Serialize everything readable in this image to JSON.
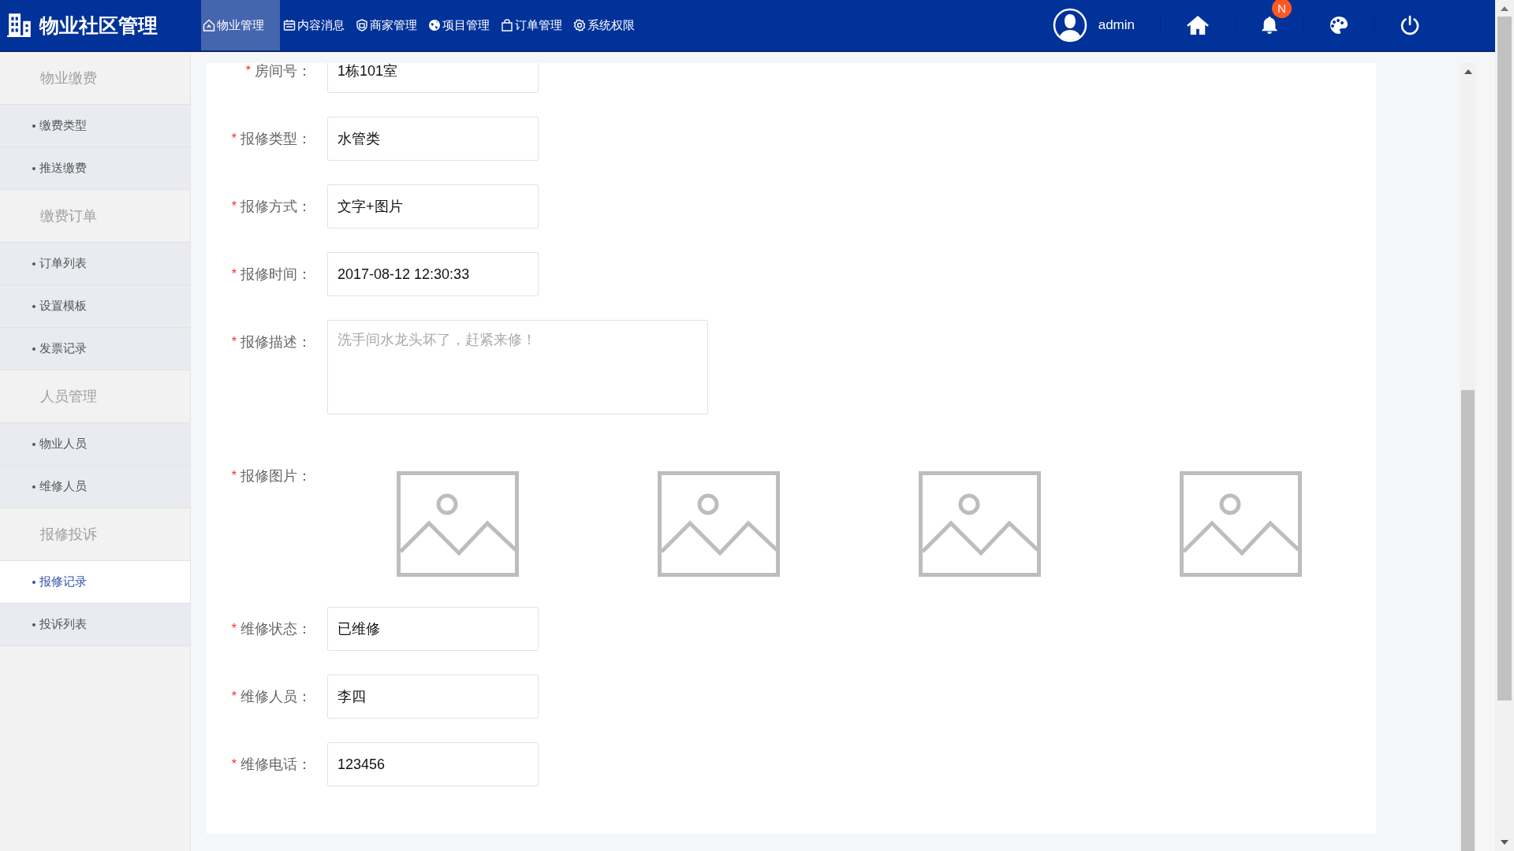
{
  "app": {
    "title": "物业社区管理"
  },
  "nav": [
    {
      "label": "物业管理",
      "selected": true
    },
    {
      "label": "内容消息",
      "selected": false
    },
    {
      "label": "商家管理",
      "selected": false
    },
    {
      "label": "项目管理",
      "selected": false
    },
    {
      "label": "订单管理",
      "selected": false
    },
    {
      "label": "系统权限",
      "selected": false
    }
  ],
  "user": {
    "name": "admin"
  },
  "notifications": {
    "badge": "N"
  },
  "sidebar": [
    {
      "title": "物业缴费",
      "items": [
        {
          "label": "缴费类型",
          "selected": false
        },
        {
          "label": "推送缴费",
          "selected": false
        }
      ]
    },
    {
      "title": "缴费订单",
      "items": [
        {
          "label": "订单列表",
          "selected": false
        },
        {
          "label": "设置模板",
          "selected": false
        },
        {
          "label": "发票记录",
          "selected": false
        }
      ]
    },
    {
      "title": "人员管理",
      "items": [
        {
          "label": "物业人员",
          "selected": false
        },
        {
          "label": "维修人员",
          "selected": false
        }
      ]
    },
    {
      "title": "报修投诉",
      "items": [
        {
          "label": "报修记录",
          "selected": true
        },
        {
          "label": "投诉列表",
          "selected": false
        }
      ]
    }
  ],
  "form": {
    "fields": [
      {
        "kind": "input",
        "required_mark": "*",
        "label": "房间号：",
        "value": "1栋101室"
      },
      {
        "kind": "input",
        "required_mark": "*",
        "label": "报修类型：",
        "value": "水管类"
      },
      {
        "kind": "input",
        "required_mark": "*",
        "label": "报修方式：",
        "value": "文字+图片"
      },
      {
        "kind": "input",
        "required_mark": "*",
        "label": "报修时间：",
        "value": "2017-08-12 12:30:33"
      },
      {
        "kind": "textarea",
        "required_mark": "*",
        "label": "报修描述：",
        "placeholder": "洗手间水龙头坏了，赶紧来修！"
      },
      {
        "kind": "images",
        "required_mark": "*",
        "label": "报修图片：",
        "images": [
          {
            "kind": "placeholder"
          },
          {
            "kind": "placeholder"
          },
          {
            "kind": "placeholder"
          },
          {
            "kind": "placeholder"
          }
        ]
      },
      {
        "kind": "input",
        "required_mark": "*",
        "label": "维修状态：",
        "value": "已维修"
      },
      {
        "kind": "input",
        "required_mark": "*",
        "label": "维修人员：",
        "value": "李四"
      },
      {
        "kind": "input",
        "required_mark": "*",
        "label": "维修电话：",
        "value": "123456"
      }
    ]
  }
}
